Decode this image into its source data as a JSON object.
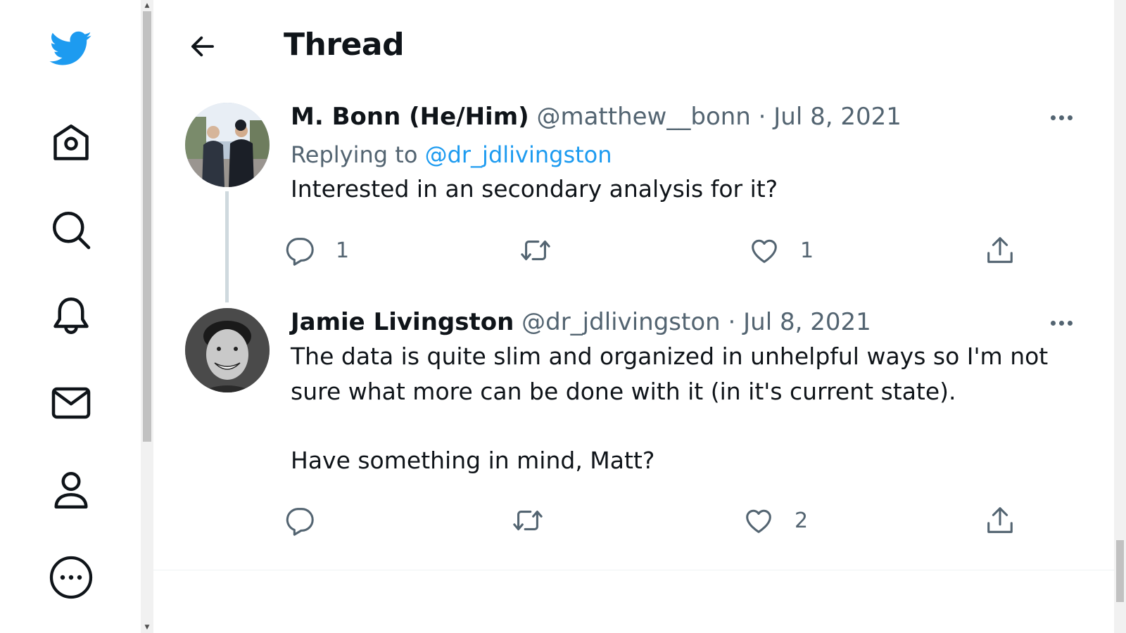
{
  "nav": {
    "items": [
      "logo-icon",
      "home-icon",
      "search-icon",
      "notifications-icon",
      "messages-icon",
      "profile-icon",
      "more-icon"
    ]
  },
  "header": {
    "title": "Thread"
  },
  "tweets": [
    {
      "name": "M. Bonn (He/Him)",
      "handle": "@matthew__bonn",
      "sep": "·",
      "date": "Jul 8, 2021",
      "reply_prefix": "Replying to ",
      "reply_handle": "@dr_jdlivingston",
      "text": "Interested in an secondary analysis for it?",
      "reply_count": "1",
      "retweet_count": "",
      "like_count": "1"
    },
    {
      "name": "Jamie Livingston",
      "handle": "@dr_jdlivingston",
      "sep": "·",
      "date": "Jul 8, 2021",
      "text_line1": "The data is quite slim and organized in unhelpful ways so I'm not",
      "text_line2": "sure what more can be done with it (in it's current state).",
      "text_line3": "Have something in mind, Matt?",
      "reply_count": "",
      "retweet_count": "",
      "like_count": "2"
    }
  ],
  "colors": {
    "accent": "#1d9bf0",
    "text": "#0f1419",
    "muted": "#536471"
  }
}
